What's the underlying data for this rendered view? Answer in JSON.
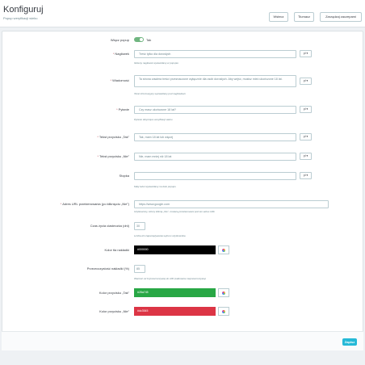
{
  "header": {
    "title": "Konfiguruj",
    "subtitle": "Popup weryfikacji wieku",
    "buttons": {
      "back": "Wstecz",
      "translate": "Tłumacz",
      "manage_hooks": "Zarządzaj zaczepami"
    }
  },
  "form": {
    "enable": {
      "label": "Włącz popup",
      "value": "Tak",
      "on": true
    },
    "heading": {
      "label": "Nagłówek",
      "value": "Treść tylko dla dorosłych",
      "help": "Główny nagłówek wyświetlany w popupie",
      "lang": "pl ▾"
    },
    "message": {
      "label": "Wiadomość",
      "value": "Ta strona zawiera treści przeznaczone wyłącznie dla osób dorosłych. Aby wejść, musisz mieć ukończone 18 lat.",
      "help": "Tekst informacyjny wyświetlany pod nagłówkiem",
      "lang": "pl ▾"
    },
    "question": {
      "label": "Pytanie",
      "value": "Czy masz ukończone 18 lat?",
      "help": "Pytanie dotyczące weryfikacji wieku",
      "lang": "pl ▾"
    },
    "yes_text": {
      "label": "Tekst przycisku „Tak”",
      "value": "Tak, mam 18 lat lub więcej",
      "lang": "pl ▾"
    },
    "no_text": {
      "label": "Tekst przycisku „Nie”",
      "value": "Nie, mam mniej niż 18 lat",
      "lang": "pl ▾"
    },
    "footer": {
      "label": "Stopka",
      "value": "",
      "help": "Mały tekst wyświetlany na dole popupu",
      "lang": "pl ▾"
    },
    "redirect": {
      "label": "Adres URL przekierowania (po kliknięciu „Nie”)",
      "value": "https://www.google.com",
      "help": "Użytkownicy, którzy kliknią „Nie”, zostaną przekierowani pod ten adres URL"
    },
    "cookie": {
      "label": "Czas życia ciasteczka (dni)",
      "value": "30",
      "help": "Liczba dni zapamiętywania wyboru użytkownika"
    },
    "overlay_color": {
      "label": "Kolor tła nakładki",
      "value": "#000000"
    },
    "overlay_opacity": {
      "label": "Przezroczystość nakładki (%)",
      "value": "85",
      "help": "Wartość od 0 (przezroczysta) do 100 (całkowicie nieprzezroczysta)"
    },
    "yes_color": {
      "label": "Kolor przycisku „Tak”",
      "value": "#28a745"
    },
    "no_color": {
      "label": "Kolor przycisku „Nie”",
      "value": "#dc3545"
    }
  },
  "footer": {
    "save": "Zapisz"
  },
  "colors": {
    "accent": "#25b9d7",
    "toggle_on": "#70b580",
    "overlay": "#000000",
    "yes": "#28a745",
    "no": "#dc3545"
  }
}
